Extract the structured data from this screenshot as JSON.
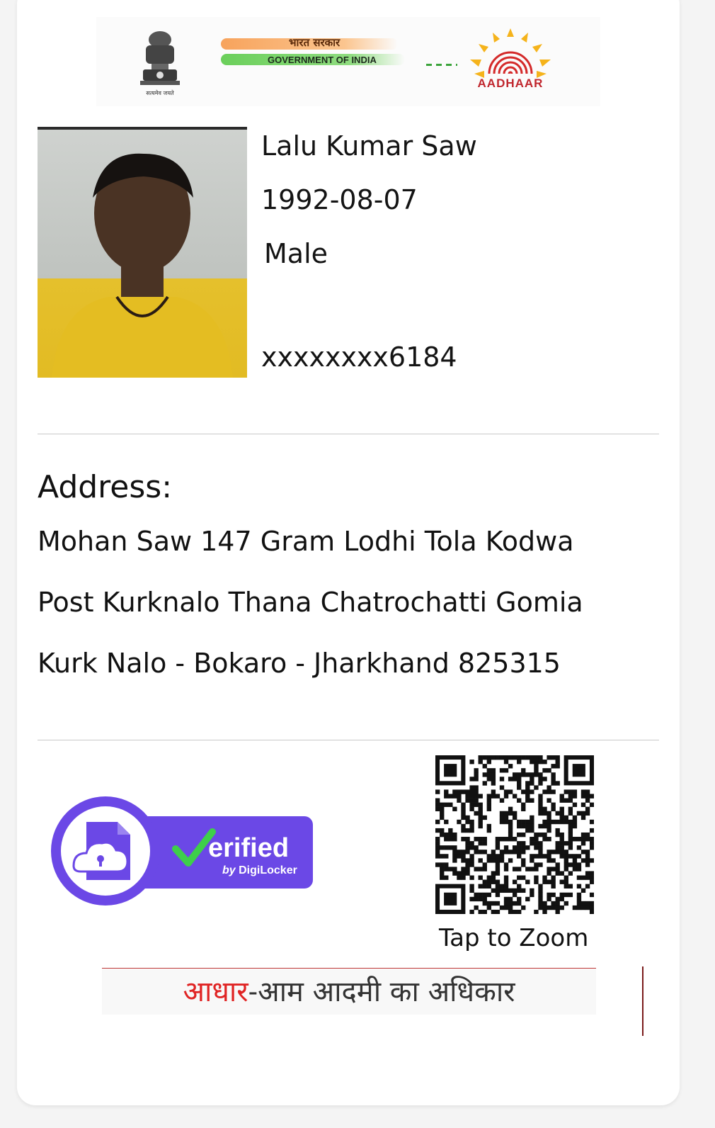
{
  "header": {
    "emblem_caption": "सत्यमेव जयते",
    "gov_hindi": "भारत सरकार",
    "gov_english": "GOVERNMENT OF INDIA",
    "aadhaar_logo_text": "AADHAAR"
  },
  "person": {
    "name": "Lalu Kumar Saw",
    "dob": "1992-08-07",
    "gender": "Male",
    "aadhaar_masked": "xxxxxxxx6184"
  },
  "address": {
    "label": "Address:",
    "lines": [
      "Mohan Saw 147 Gram Lodhi Tola Kodwa",
      "Post Kurknalo Thana Chatrochatti Gomia",
      "Kurk Nalo - Bokaro - Jharkhand 825315"
    ]
  },
  "verification": {
    "word": "erified",
    "by_prefix": "by ",
    "by_name": "DigiLocker",
    "brand_color": "#6b48e6",
    "check_color": "#3ecf4a"
  },
  "qr": {
    "tap_label": "Tap to Zoom"
  },
  "footer": {
    "slogan_red": "आधार",
    "slogan_rest": "-आम आदमी का अधिकार"
  },
  "icons": [
    "national-emblem-icon",
    "aadhaar-fingerprint-icon",
    "document-cloud-lock-icon",
    "checkmark-icon",
    "qr-code-icon"
  ]
}
